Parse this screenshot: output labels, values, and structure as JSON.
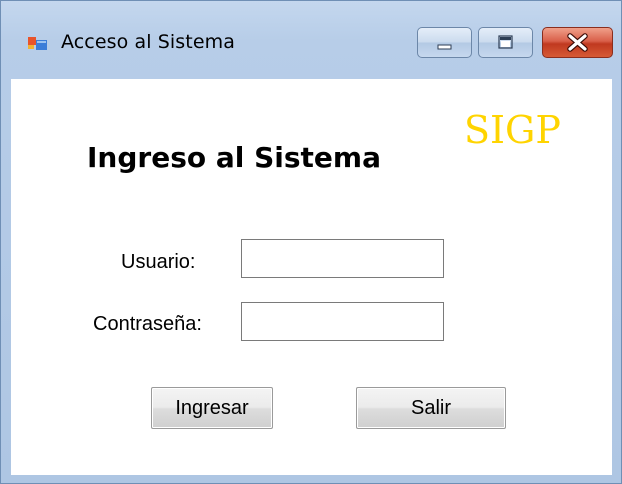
{
  "window": {
    "title": "Acceso al Sistema"
  },
  "form": {
    "logo": "SIGP",
    "heading": "Ingreso al Sistema",
    "username_label": "Usuario:",
    "username_value": "",
    "password_label": "Contraseña:",
    "password_value": "",
    "login_button": "Ingresar",
    "exit_button": "Salir"
  },
  "icons": {
    "app": "app-window-icon",
    "minimize": "minimize-icon",
    "maximize": "maximize-icon",
    "close": "close-icon"
  },
  "colors": {
    "logo": "#ffd400",
    "close_button": "#c8452c"
  }
}
